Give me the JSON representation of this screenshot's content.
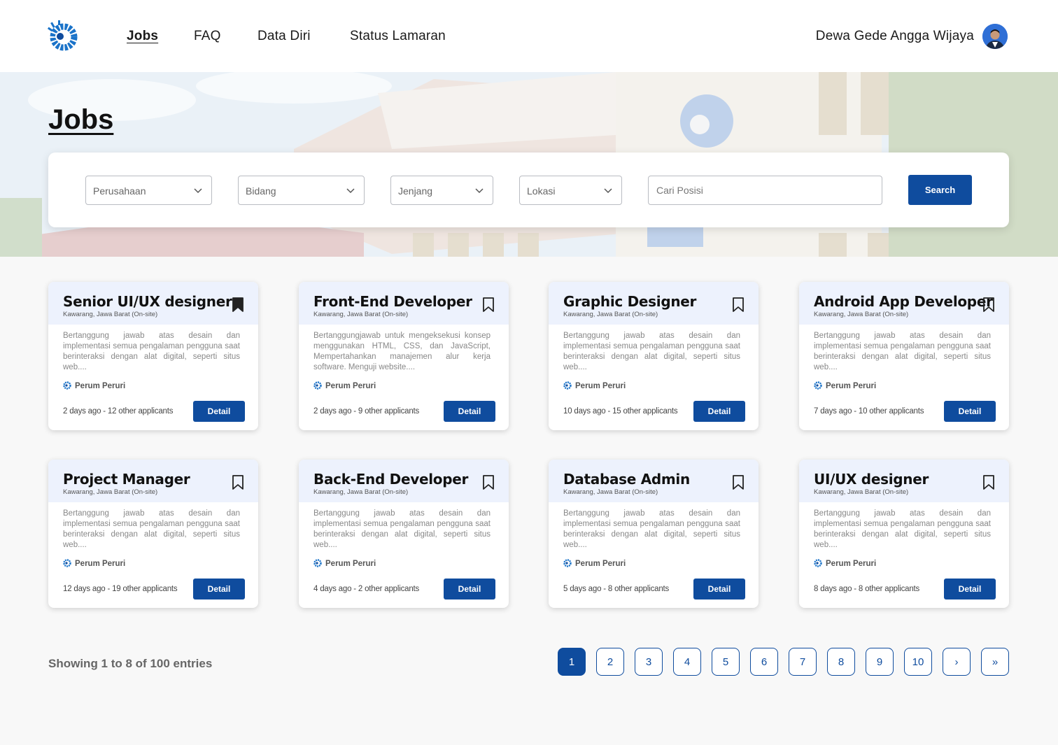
{
  "nav": {
    "links": [
      {
        "label": "Jobs",
        "active": true
      },
      {
        "label": "FAQ",
        "active": false
      },
      {
        "label": "Data Diri",
        "active": false
      },
      {
        "label": "Status Lamaran",
        "active": false
      }
    ],
    "user_name": "Dewa Gede Angga Wijaya"
  },
  "hero": {
    "title": "Jobs"
  },
  "filters": {
    "company_placeholder": "Perusahaan",
    "field_placeholder": "Bidang",
    "level_placeholder": "Jenjang",
    "location_placeholder": "Lokasi",
    "position_placeholder": "Cari Posisi",
    "search_label": "Search"
  },
  "colors": {
    "primary": "#0f4c9e",
    "card_header": "#edf2fd"
  },
  "jobs": [
    {
      "title": "Senior UI/UX designer",
      "location": "Kawarang, Jawa Barat (On-site)",
      "description": "Bertanggung jawab atas desain dan implementasi semua pengalaman pengguna saat berinteraksi dengan alat digital, seperti situs web....",
      "company": "Perum Peruri",
      "meta": "2 days ago - 12 other applicants",
      "bookmarked": true,
      "detail_label": "Detail"
    },
    {
      "title": "Front-End Developer",
      "location": "Kawarang, Jawa Barat (On-site)",
      "description": "Bertanggungjawab untuk mengeksekusi konsep menggunakan HTML, CSS, dan JavaScript, Mempertahankan manajemen alur kerja software. Menguji website....",
      "company": "Perum Peruri",
      "meta": "2 days ago - 9 other applicants",
      "bookmarked": false,
      "detail_label": "Detail"
    },
    {
      "title": "Graphic Designer",
      "location": "Kawarang, Jawa Barat (On-site)",
      "description": "Bertanggung jawab atas desain dan implementasi semua pengalaman pengguna saat berinteraksi dengan alat digital, seperti situs web....",
      "company": "Perum Peruri",
      "meta": "10 days ago - 15 other applicants",
      "bookmarked": false,
      "detail_label": "Detail"
    },
    {
      "title": "Android App Developer",
      "location": "Kawarang, Jawa Barat (On-site)",
      "description": "Bertanggung jawab atas desain dan implementasi semua pengalaman pengguna saat berinteraksi dengan alat digital, seperti situs web....",
      "company": "Perum Peruri",
      "meta": "7 days ago - 10 other applicants",
      "bookmarked": false,
      "detail_label": "Detail"
    },
    {
      "title": "Project Manager",
      "location": "Kawarang, Jawa Barat (On-site)",
      "description": "Bertanggung jawab atas desain dan implementasi semua pengalaman pengguna saat berinteraksi dengan alat digital, seperti situs web....",
      "company": "Perum Peruri",
      "meta": "12 days ago - 19 other applicants",
      "bookmarked": false,
      "detail_label": "Detail"
    },
    {
      "title": "Back-End Developer",
      "location": "Kawarang, Jawa Barat (On-site)",
      "description": "Bertanggung jawab atas desain dan implementasi semua pengalaman pengguna saat berinteraksi dengan alat digital, seperti situs web....",
      "company": "Perum Peruri",
      "meta": "4 days ago - 2 other applicants",
      "bookmarked": false,
      "detail_label": "Detail"
    },
    {
      "title": "Database Admin",
      "location": "Kawarang, Jawa Barat (On-site)",
      "description": "Bertanggung jawab atas desain dan implementasi semua pengalaman pengguna saat berinteraksi dengan alat digital, seperti situs web....",
      "company": "Perum Peruri",
      "meta": "5 days ago - 8 other applicants",
      "bookmarked": false,
      "detail_label": "Detail"
    },
    {
      "title": "UI/UX designer",
      "location": "Kawarang, Jawa Barat (On-site)",
      "description": "Bertanggung jawab atas desain dan implementasi semua pengalaman pengguna saat berinteraksi dengan alat digital, seperti situs web....",
      "company": "Perum Peruri",
      "meta": "8 days ago - 8 other applicants",
      "bookmarked": false,
      "detail_label": "Detail"
    }
  ],
  "pagination": {
    "showing": "Showing 1 to 8 of 100 entries",
    "pages": [
      "1",
      "2",
      "3",
      "4",
      "5",
      "6",
      "7",
      "8",
      "9",
      "10"
    ],
    "current": "1",
    "next_label": "›",
    "last_label": "»"
  }
}
